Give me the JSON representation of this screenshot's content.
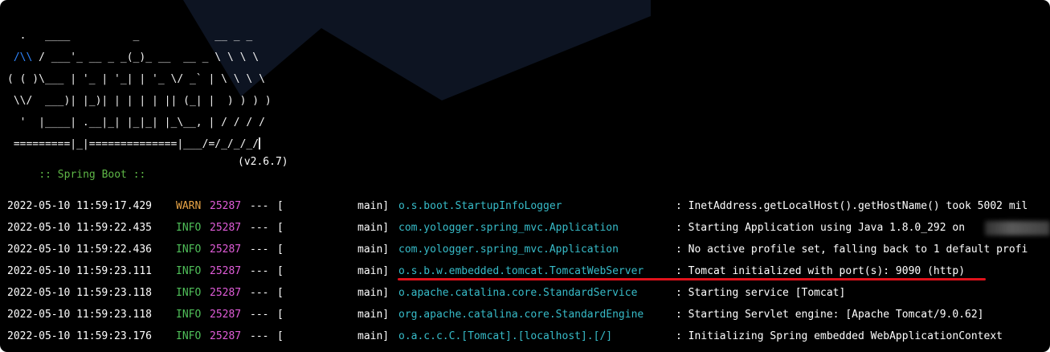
{
  "terminal": {
    "banner_lines": [
      "  .   ____          _            __ _ _",
      " /\\\\ / ___'_ __ _ _(_)_ __  __ _ \\ \\ \\ \\",
      "( ( )\\___ | '_ | '_| | '_ \\/ _` | \\ \\ \\ \\",
      " \\\\/  ___)| |_)| | | | | || (_| |  ) ) ) )",
      "  '  |____| .__|_| |_|_| |_\\__, | / / / /",
      " =========|_|==============|___/=/_/_/_/"
    ],
    "banner_blue": "/\\\\",
    "spring_label": ":: Spring Boot ::",
    "spring_version": "(v2.6.7)",
    "colors": {
      "background": "#000000",
      "warn": "#e8a446",
      "info": "#4fbf59",
      "pid": "#e05cd8",
      "logger": "#37bcc9",
      "spring": "#5fb847",
      "highlight": "#e0121b"
    },
    "logs": [
      {
        "date": "2022-05-10 11:59:17.429",
        "level": "WARN",
        "pid": "25287",
        "dash": "---",
        "bracket": "[",
        "thread": "main]",
        "logger": "o.s.boot.StartupInfoLogger",
        "message": ": InetAddress.getLocalHost().getHostName() took 5002 mil"
      },
      {
        "date": "2022-05-10 11:59:22.435",
        "level": "INFO",
        "pid": "25287",
        "dash": "---",
        "bracket": "[",
        "thread": "main]",
        "logger": "com.yologger.spring_mvc.Application",
        "message": ": Starting Application using Java 1.8.0_292 on"
      },
      {
        "date": "2022-05-10 11:59:22.436",
        "level": "INFO",
        "pid": "25287",
        "dash": "---",
        "bracket": "[",
        "thread": "main]",
        "logger": "com.yologger.spring_mvc.Application",
        "message": ": No active profile set, falling back to 1 default profi"
      },
      {
        "date": "2022-05-10 11:59:23.111",
        "level": "INFO",
        "pid": "25287",
        "dash": "---",
        "bracket": "[",
        "thread": "main]",
        "logger": "o.s.b.w.embedded.tomcat.TomcatWebServer",
        "message": ": Tomcat initialized with port(s): 9090 (http)"
      },
      {
        "date": "2022-05-10 11:59:23.118",
        "level": "INFO",
        "pid": "25287",
        "dash": "---",
        "bracket": "[",
        "thread": "main]",
        "logger": "o.apache.catalina.core.StandardService",
        "message": ": Starting service [Tomcat]"
      },
      {
        "date": "2022-05-10 11:59:23.118",
        "level": "INFO",
        "pid": "25287",
        "dash": "---",
        "bracket": "[",
        "thread": "main]",
        "logger": "org.apache.catalina.core.StandardEngine",
        "message": ": Starting Servlet engine: [Apache Tomcat/9.0.62]"
      },
      {
        "date": "2022-05-10 11:59:23.176",
        "level": "INFO",
        "pid": "25287",
        "dash": "---",
        "bracket": "[",
        "thread": "main]",
        "logger": "o.a.c.c.C.[Tomcat].[localhost].[/]",
        "message": ": Initializing Spring embedded WebApplicationContext"
      }
    ]
  }
}
